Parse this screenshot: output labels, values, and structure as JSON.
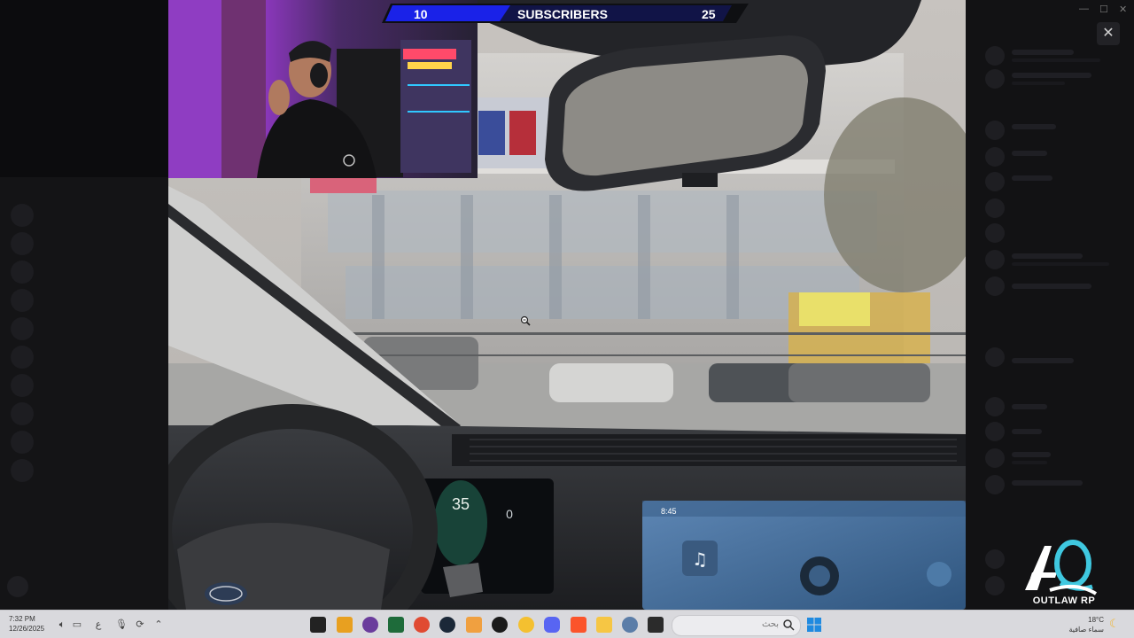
{
  "stream_overlay": {
    "subscribers_left": "10",
    "subscribers_label": "SUBSCRIBERS",
    "subscribers_right": "25",
    "bar_color": "#1a22e8"
  },
  "brand": {
    "logo_text": "OUTLAW RP",
    "accent": "#3fc8e0"
  },
  "viewer": {
    "close_label": "✕"
  },
  "taskbar": {
    "time": "7:32 PM",
    "date": "12/26/2025",
    "lang": "ع",
    "search_placeholder": "بحث",
    "weather_temp": "18°C",
    "weather_desc": "سماء صافية"
  },
  "icons": [
    "microphone-icon",
    "wifi-icon",
    "volume-icon",
    "battery-icon",
    "chevron-up-icon",
    "search-icon",
    "windows-start-icon",
    "moon-icon",
    "zoom-cursor-icon",
    "close-icon"
  ],
  "app_icons": [
    "call-of-duty",
    "vlc-or-cone",
    "obs-studio",
    "excel",
    "chrome",
    "steam",
    "artix",
    "rockstar",
    "mail",
    "discord",
    "brave",
    "file-explorer",
    "settings",
    "terminal"
  ]
}
